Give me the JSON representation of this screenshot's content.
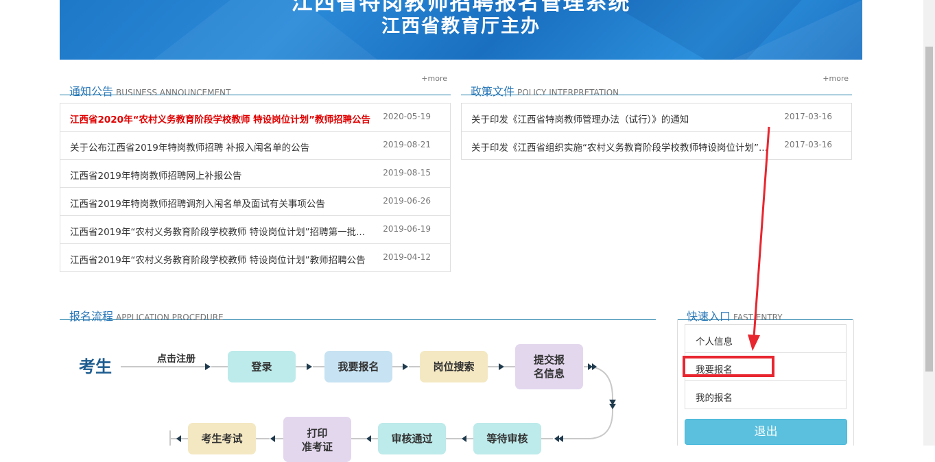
{
  "banner": {
    "title": "江西省特岗教师招聘报名管理系统",
    "subtitle": "江西省教育厅主办"
  },
  "notice": {
    "title_zh": "通知公告",
    "title_en": "BUSINESS ANNOUNCEMENT",
    "more": "+more",
    "items": [
      {
        "title": "江西省2020年“农村义务教育阶段学校教师 特设岗位计划”教师招聘公告",
        "date": "2020-05-19"
      },
      {
        "title": "关于公布江西省2019年特岗教师招聘 补报入闱名单的公告",
        "date": "2019-08-21"
      },
      {
        "title": "江西省2019年特岗教师招聘网上补报公告",
        "date": "2019-08-15"
      },
      {
        "title": "江西省2019年特岗教师招聘调剂入闱名单及面试有关事项公告",
        "date": "2019-06-26"
      },
      {
        "title": "江西省2019年“农村义务教育阶段学校教师 特设岗位计划”招聘第一批...",
        "date": "2019-06-19"
      },
      {
        "title": "江西省2019年“农村义务教育阶段学校教师 特设岗位计划”教师招聘公告",
        "date": "2019-04-12"
      }
    ]
  },
  "policy": {
    "title_zh": "政策文件",
    "title_en": "POLICY INTERPRETATION",
    "more": "+more",
    "items": [
      {
        "title": "关于印发《江西省特岗教师管理办法（试行）》的通知",
        "date": "2017-03-16"
      },
      {
        "title": "关于印发《江西省组织实施“农村义务教育阶段学校教师特设岗位计划”...",
        "date": "2017-03-16"
      }
    ]
  },
  "procedure": {
    "title_zh": "报名流程",
    "title_en": "APPLICATION PROCEDURE",
    "candidate": "考生",
    "register": "点击注册",
    "steps": {
      "login": "登录",
      "apply": "我要报名",
      "search": "岗位搜索",
      "submit_1": "提交报",
      "submit_2": "名信息",
      "wait": "等待审核",
      "pass": "审核通过",
      "print_1": "打印",
      "print_2": "准考证",
      "exam": "考生考试"
    }
  },
  "quick": {
    "title_zh": "快速入口",
    "title_en": "FAST ENTRY",
    "items": [
      "个人信息",
      "我要报名",
      "我的报名"
    ],
    "logout": "退出"
  },
  "colors": {
    "accent": "#2b78b8",
    "hot": "#e00000",
    "annotation": "#e8262f",
    "logout": "#5bc0de"
  }
}
